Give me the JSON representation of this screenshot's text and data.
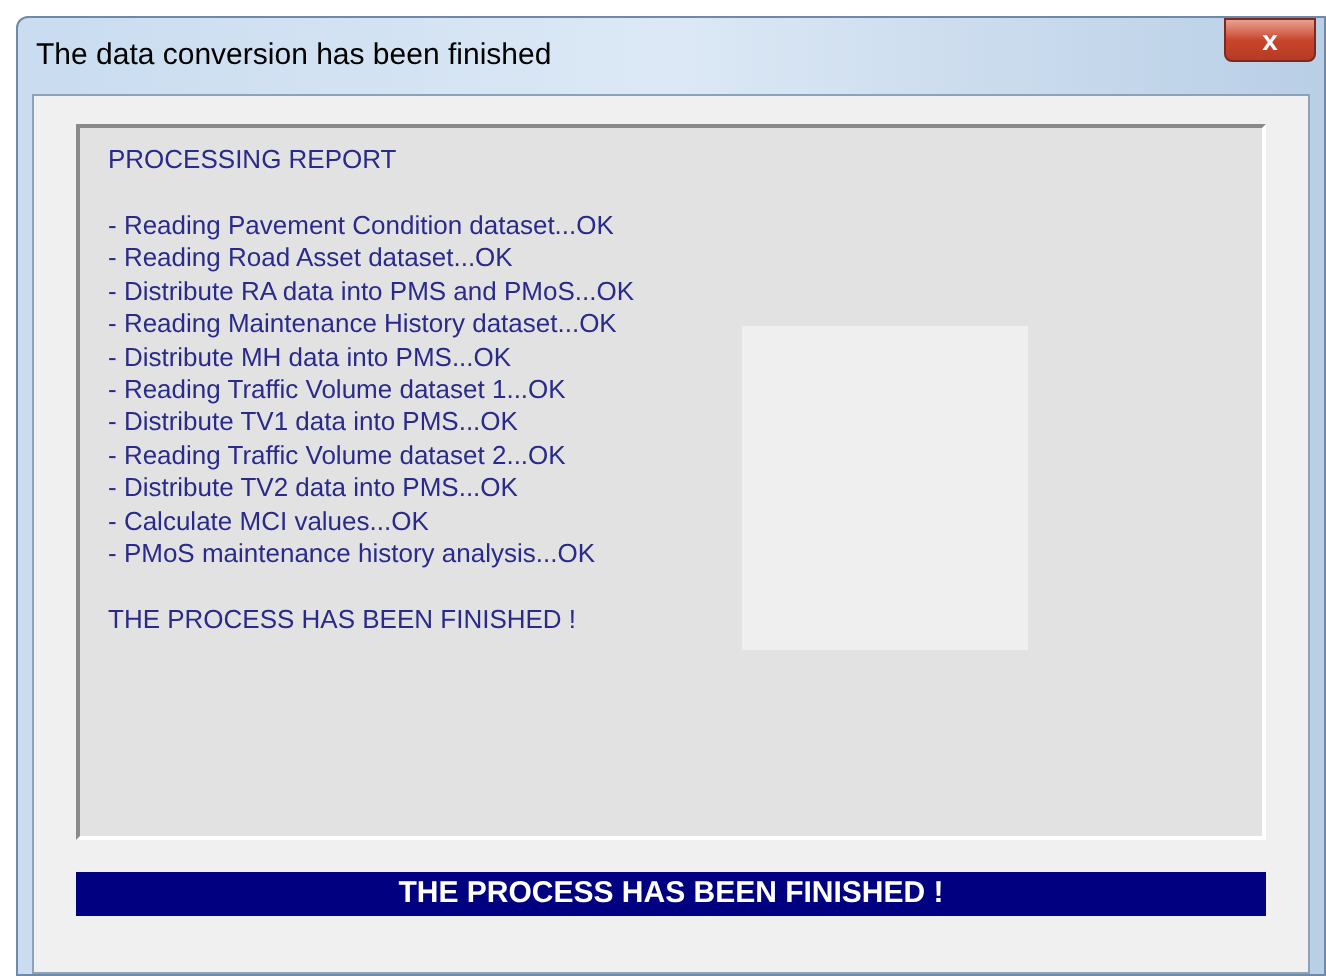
{
  "window": {
    "title": "The data conversion has been finished",
    "close_button": "x"
  },
  "report": {
    "heading": "PROCESSING REPORT",
    "lines": [
      "- Reading Pavement Condition dataset...OK",
      "- Reading Road Asset dataset...OK",
      "- Distribute RA data into PMS and PMoS...OK",
      "- Reading Maintenance History dataset...OK",
      "- Distribute MH data into PMS...OK",
      "- Reading Traffic Volume dataset 1...OK",
      "- Distribute TV1 data into PMS...OK",
      "- Reading Traffic Volume dataset 2...OK",
      "- Distribute TV2 data into PMS...OK",
      "- Calculate MCI values...OK",
      "- PMoS maintenance history analysis...OK"
    ],
    "footer": "THE PROCESS HAS BEEN FINISHED !"
  },
  "status_bar": {
    "text": "THE PROCESS HAS BEEN FINISHED !"
  }
}
